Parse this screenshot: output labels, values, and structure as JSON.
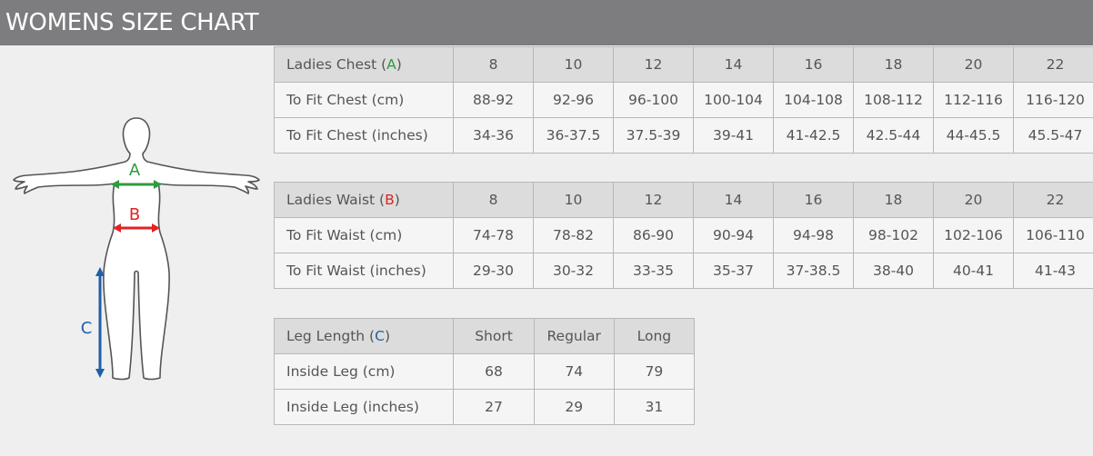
{
  "header": {
    "title": "WOMENS SIZE CHART"
  },
  "figure": {
    "label_a": "A",
    "label_b": "B",
    "label_c": "C",
    "colors": {
      "a": "#2e9b3e",
      "b": "#e02424",
      "c": "#1f5fa8",
      "outline": "#555555"
    }
  },
  "tables": {
    "chest": {
      "header_text": "Ladies Chest (",
      "header_letter": "A",
      "header_close": ")",
      "letter_color": "#2e9b3e",
      "columns": [
        "8",
        "10",
        "12",
        "14",
        "16",
        "18",
        "20",
        "22"
      ],
      "rows": [
        {
          "label": "To Fit Chest (cm)",
          "values": [
            "88-92",
            "92-96",
            "96-100",
            "100-104",
            "104-108",
            "108-112",
            "112-116",
            "116-120"
          ]
        },
        {
          "label": "To Fit Chest (inches)",
          "values": [
            "34-36",
            "36-37.5",
            "37.5-39",
            "39-41",
            "41-42.5",
            "42.5-44",
            "44-45.5",
            "45.5-47"
          ]
        }
      ]
    },
    "waist": {
      "header_text": "Ladies Waist (",
      "header_letter": "B",
      "header_close": ")",
      "letter_color": "#e02424",
      "columns": [
        "8",
        "10",
        "12",
        "14",
        "16",
        "18",
        "20",
        "22"
      ],
      "rows": [
        {
          "label": "To Fit Waist (cm)",
          "values": [
            "74-78",
            "78-82",
            "86-90",
            "90-94",
            "94-98",
            "98-102",
            "102-106",
            "106-110"
          ]
        },
        {
          "label": "To Fit Waist (inches)",
          "values": [
            "29-30",
            "30-32",
            "33-35",
            "35-37",
            "37-38.5",
            "38-40",
            "40-41",
            "41-43"
          ]
        }
      ]
    },
    "leg": {
      "header_text": "Leg Length (",
      "header_letter": "C",
      "header_close": ")",
      "letter_color": "#1f5fa8",
      "columns": [
        "Short",
        "Regular",
        "Long"
      ],
      "rows": [
        {
          "label": "Inside Leg (cm)",
          "values": [
            "68",
            "74",
            "79"
          ]
        },
        {
          "label": "Inside Leg (inches)",
          "values": [
            "27",
            "29",
            "31"
          ]
        }
      ]
    }
  }
}
